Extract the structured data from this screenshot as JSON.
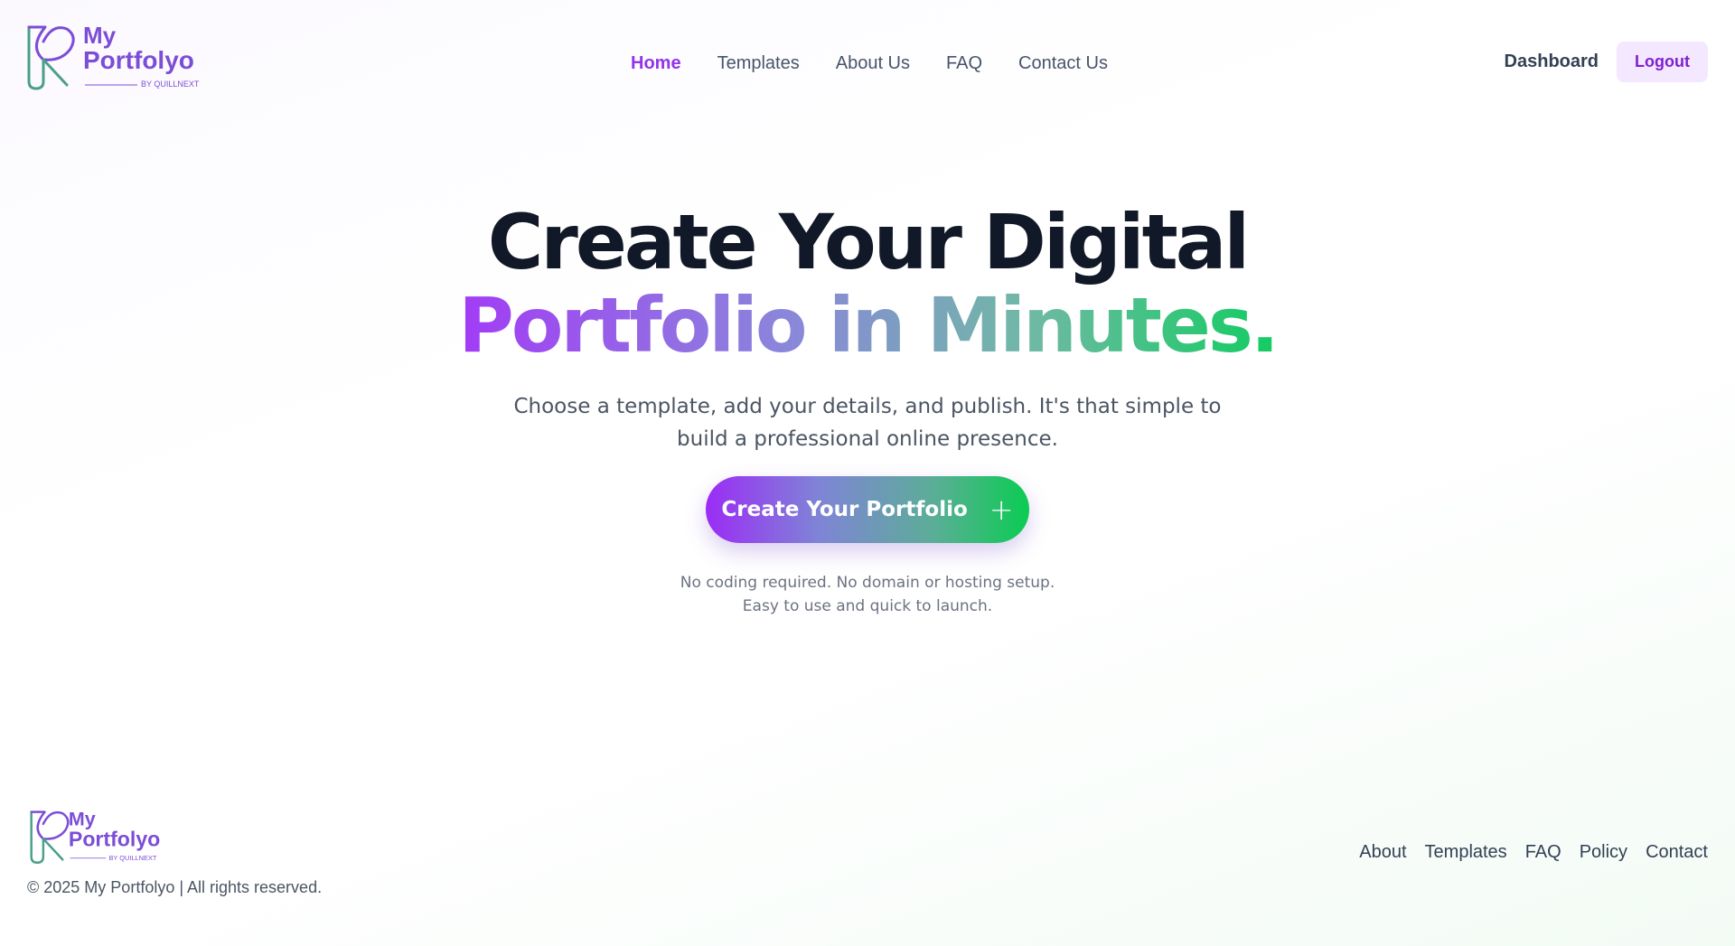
{
  "brand": {
    "name_line1": "My",
    "name_line2": "Portfolyo",
    "tagline": "BY QUILLNEXT",
    "colors": {
      "purple": "#7c4dd6",
      "teal": "#4a9f8a"
    }
  },
  "nav": {
    "items": [
      {
        "label": "Home",
        "active": true
      },
      {
        "label": "Templates",
        "active": false
      },
      {
        "label": "About Us",
        "active": false
      },
      {
        "label": "FAQ",
        "active": false
      },
      {
        "label": "Contact Us",
        "active": false
      }
    ],
    "dashboard_label": "Dashboard",
    "logout_label": "Logout"
  },
  "hero": {
    "title_line1": "Create Your Digital",
    "title_line2": "Portfolio in Minutes.",
    "subtitle": "Choose a template, add your details, and publish. It's that simple to build a professional online presence.",
    "cta_label": "Create Your Portfolio",
    "cta_icon": "plus-icon",
    "note_line1": "No coding required. No domain or hosting setup.",
    "note_line2": "Easy to use and quick to launch."
  },
  "footer": {
    "copyright": "© 2025 My Portfolyo | All rights reserved.",
    "links": [
      "About",
      "Templates",
      "FAQ",
      "Policy",
      "Contact"
    ]
  },
  "colors": {
    "accent": "#9333ea",
    "gradient_start": "#9b2cf5",
    "gradient_end": "#0bcc52"
  }
}
